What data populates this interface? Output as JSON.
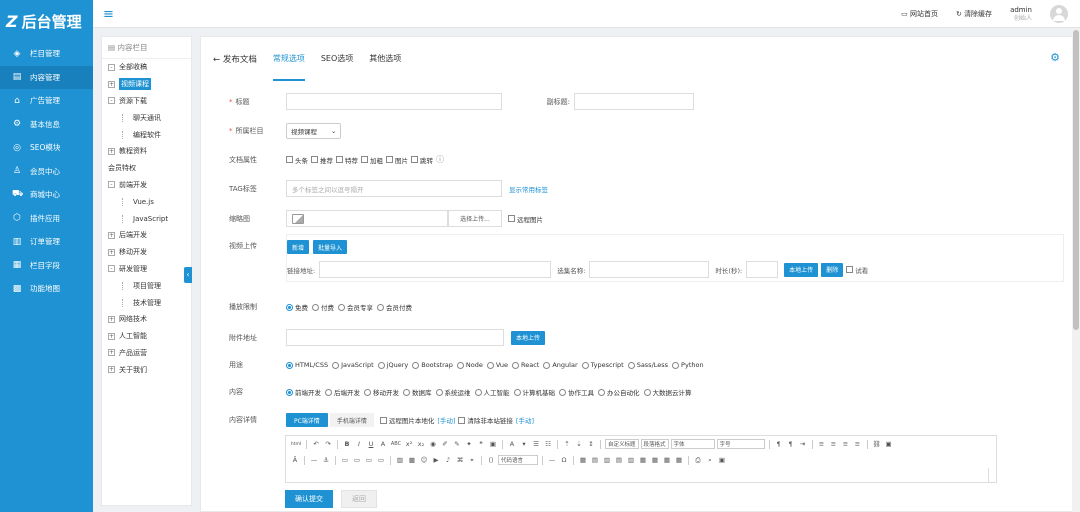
{
  "app": {
    "logo_mark": "Z",
    "logo_text": "后台管理"
  },
  "sidebar": {
    "items": [
      {
        "icon": "layers-icon",
        "glyph": "◈",
        "label": "栏目管理"
      },
      {
        "icon": "document-icon",
        "glyph": "▤",
        "label": "内容管理",
        "active": true
      },
      {
        "icon": "home-icon",
        "glyph": "⌂",
        "label": "广告管理"
      },
      {
        "icon": "gear-icon",
        "glyph": "⚙",
        "label": "基本信息"
      },
      {
        "icon": "seo-icon",
        "glyph": "◎",
        "label": "SEO模块"
      },
      {
        "icon": "user-icon",
        "glyph": "♙",
        "label": "会员中心"
      },
      {
        "icon": "cart-icon",
        "glyph": "⛟",
        "label": "商城中心"
      },
      {
        "icon": "plugin-icon",
        "glyph": "⬡",
        "label": "插件应用"
      },
      {
        "icon": "order-icon",
        "glyph": "▥",
        "label": "订单管理"
      },
      {
        "icon": "field-icon",
        "glyph": "▦",
        "label": "栏目字段"
      },
      {
        "icon": "grid-icon",
        "glyph": "▩",
        "label": "功能地图"
      }
    ]
  },
  "topbar": {
    "home": "网站首页",
    "cache": "清除缓存",
    "user": "admin",
    "role": "创始人"
  },
  "tree": {
    "title": "内容栏目",
    "items": [
      {
        "label": "全部收稿",
        "pm": "-",
        "indent": 0
      },
      {
        "label": "视频课程",
        "pm": "+",
        "indent": 0,
        "hl": true
      },
      {
        "label": "资源下载",
        "pm": "-",
        "indent": 0
      },
      {
        "label": "聊天通讯",
        "pm": "",
        "indent": 1
      },
      {
        "label": "编程软件",
        "pm": "",
        "indent": 1
      },
      {
        "label": "教程资料",
        "pm": "+",
        "indent": 0
      },
      {
        "label": "会员特权",
        "pm": "",
        "indent": 0
      },
      {
        "label": "前端开发",
        "pm": "-",
        "indent": 0
      },
      {
        "label": "Vue.js",
        "pm": "",
        "indent": 1
      },
      {
        "label": "JavaScript",
        "pm": "",
        "indent": 1
      },
      {
        "label": "后端开发",
        "pm": "+",
        "indent": 0
      },
      {
        "label": "移动开发",
        "pm": "+",
        "indent": 0
      },
      {
        "label": "研发管理",
        "pm": "-",
        "indent": 0
      },
      {
        "label": "项目管理",
        "pm": "",
        "indent": 1
      },
      {
        "label": "技术管理",
        "pm": "",
        "indent": 1
      },
      {
        "label": "网络技术",
        "pm": "+",
        "indent": 0
      },
      {
        "label": "人工智能",
        "pm": "+",
        "indent": 0
      },
      {
        "label": "产品运营",
        "pm": "+",
        "indent": 0
      },
      {
        "label": "关于我们",
        "pm": "+",
        "indent": 0
      }
    ]
  },
  "tabs": {
    "back": "← 发布文档",
    "items": [
      "常规选项",
      "SEO选项",
      "其他选项"
    ]
  },
  "form": {
    "title_label": "标题",
    "subtitle_label": "副标题:",
    "category_label": "所属栏目",
    "category_value": "视频课程",
    "attr_label": "文档属性",
    "attrs": [
      "头条",
      "推荐",
      "特荐",
      "加粗",
      "图片",
      "跳转"
    ],
    "tag_label": "TAG标签",
    "tag_placeholder": "多个标签之间以逗号隔开",
    "tag_link": "显示常用标签",
    "thumb_label": "缩略图",
    "thumb_btn": "选择上传...",
    "thumb_remote": "远程图片",
    "video_label": "视频上传",
    "video_btn_new": "新增",
    "video_btn_batch": "批量导入",
    "video_link_label": "链接地址:",
    "video_name_label": "选集名称:",
    "video_dur_label": "时长(秒):",
    "video_local_btn": "本地上传",
    "video_del_btn": "删除",
    "video_trial": "试看",
    "play_label": "播放限制",
    "play_opts": [
      "免费",
      "付费",
      "会员专享",
      "会员付费"
    ],
    "attach_label": "附件地址",
    "attach_btn": "本地上传",
    "use_label": "用途",
    "use_opts": [
      "HTML/CSS",
      "JavaScript",
      "jQuery",
      "Bootstrap",
      "Node",
      "Vue",
      "React",
      "Angular",
      "Typescript",
      "Sass/Less",
      "Python"
    ],
    "content_label": "内容",
    "content_opts": [
      "前端开发",
      "后端开发",
      "移动开发",
      "数据库",
      "系统运维",
      "人工智能",
      "计算机基础",
      "协作工具",
      "办公自动化",
      "大数据云计算"
    ],
    "detail_label": "内容详情",
    "detail_tab_pc": "PC端详情",
    "detail_tab_mobile": "手机端详情",
    "detail_opt1": "远程图片本地化",
    "detail_opt1_link": "[手动]",
    "detail_opt2": "清除非本站链接",
    "detail_opt2_link": "[手动]",
    "editor_selects": [
      "自定义标题",
      "段落格式",
      "字体",
      "字号",
      "代码语言"
    ],
    "submit": "确认提交",
    "back": "返回"
  }
}
